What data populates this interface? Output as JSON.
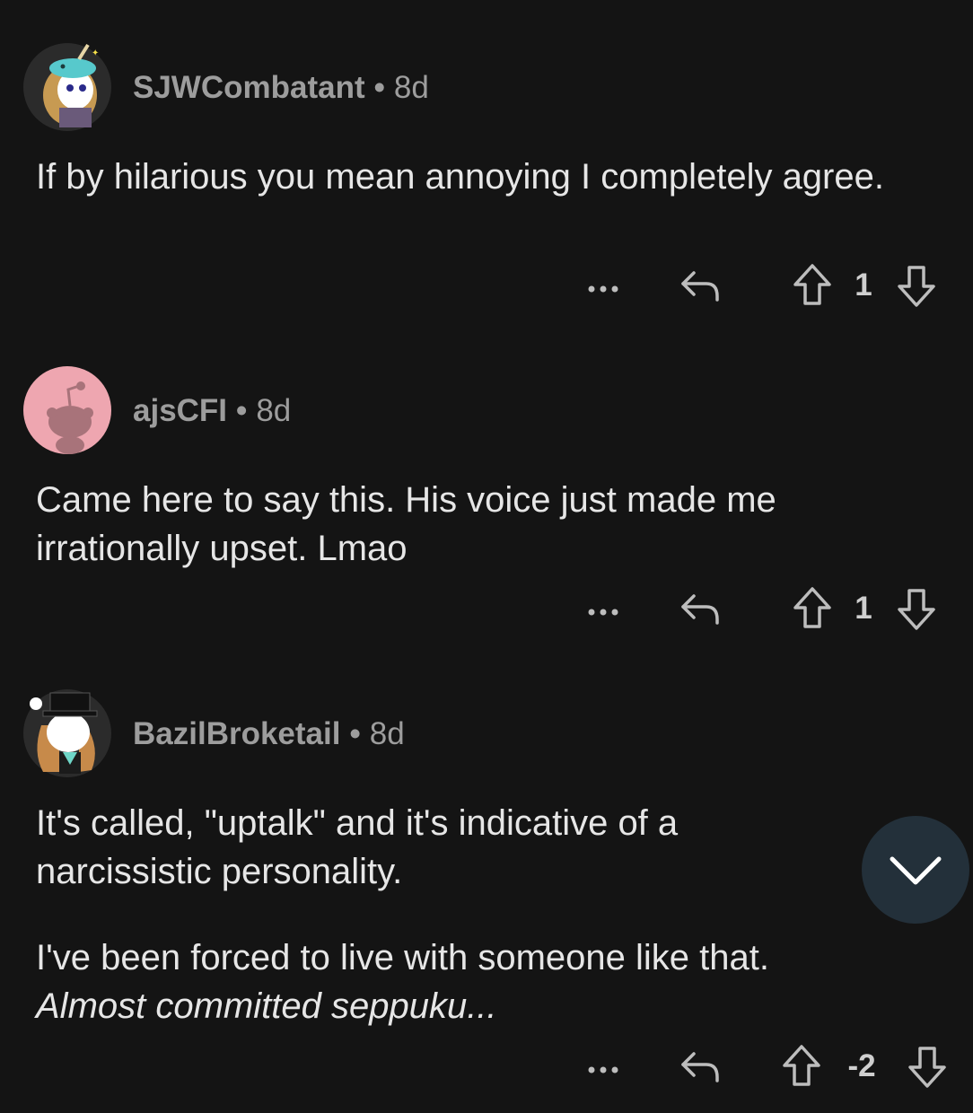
{
  "comments": [
    {
      "username": "SJWCombatant",
      "age": "8d",
      "paragraphs": [
        "If by hilarious you mean annoying I completely agree."
      ],
      "score": "1",
      "avatar_icon": "snoo-avatar-narwhal-hat-icon"
    },
    {
      "username": "ajsCFI",
      "age": "8d",
      "paragraphs": [
        "Came here to say this. His voice just made me irrationally upset. Lmao"
      ],
      "score": "1",
      "avatar_icon": "default-snoo-avatar-icon"
    },
    {
      "username": "BazilBroketail",
      "age": "8d",
      "paragraphs": [
        "It's called, \"uptalk\" and it's indicative of a narcissistic personality."
      ],
      "italic_paragraph": "I've been forced to live with someone like that.",
      "italic_text": "Almost committed seppuku...",
      "score": "-2",
      "avatar_icon": "snoo-avatar-top-hat-icon"
    }
  ],
  "separator": "•",
  "icons": {
    "more": "more-options-icon",
    "reply": "reply-icon",
    "upvote": "upvote-arrow-icon",
    "downvote": "downvote-arrow-icon",
    "scroll": "chevron-down-icon"
  },
  "colors": {
    "background": "#141414",
    "text": "#e6e6e6",
    "meta": "#9d9d9d",
    "fab": "#23303a",
    "default_avatar_bg": "#eea6b0"
  }
}
